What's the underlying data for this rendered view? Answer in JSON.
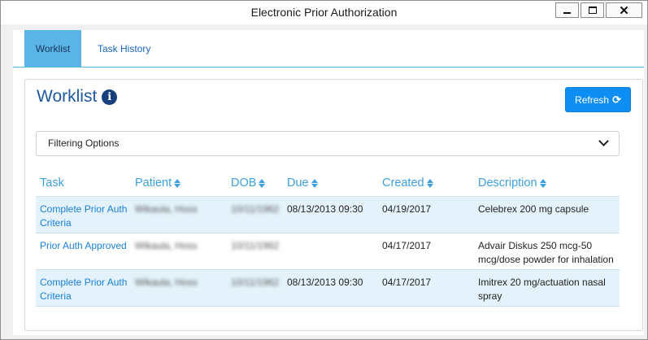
{
  "window": {
    "title": "Electronic Prior Authorization"
  },
  "tabs": [
    {
      "label": "Worklist",
      "active": true
    },
    {
      "label": "Task History",
      "active": false
    }
  ],
  "panel": {
    "title": "Worklist",
    "refresh_label": "Refresh",
    "filter_label": "Filtering Options"
  },
  "table": {
    "columns": [
      "Task",
      "Patient",
      "DOB",
      "Due",
      "Created",
      "Description"
    ],
    "rows": [
      {
        "task": "Complete Prior Auth Criteria",
        "patient": "Wikaula, Hoss",
        "dob": "10/11/1962",
        "due": "08/13/2013 09:30",
        "created": "04/19/2017",
        "description": "Celebrex 200 mg capsule"
      },
      {
        "task": "Prior Auth Approved",
        "patient": "Wikaula, Hoss",
        "dob": "10/11/1962",
        "due": "",
        "created": "04/17/2017",
        "description": "Advair Diskus 250 mcg-50 mcg/dose powder for inhalation"
      },
      {
        "task": "Complete Prior Auth Criteria",
        "patient": "Wikaula, Hoss",
        "dob": "10/11/1962",
        "due": "08/13/2013 09:30",
        "created": "04/17/2017",
        "description": "Imitrex 20 mg/actuation nasal spray"
      }
    ]
  },
  "colors": {
    "accent": "#5ab4e6",
    "link": "#1a7fd6",
    "button": "#0e8ef2",
    "row_shade": "#e4f3fb"
  }
}
